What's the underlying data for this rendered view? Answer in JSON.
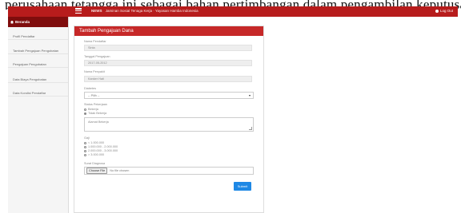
{
  "caption": "perusahaan tetangga ini sebagai bahan pertimbangan dalam pengambilan keputusan",
  "topbar": {
    "brand": "NEWS",
    "subtitle": "Jaminan Sosial Tenaga Kerja · Yayasan Hamba Indonesia",
    "logout": "Log Out"
  },
  "sidebar": {
    "header": "Beranda",
    "items": [
      "Profil Pendaftar",
      "Tambah Pengajuan Pengobatan",
      "Pengajuan Pengobatan",
      "Data Biaya Pengobatan",
      "Data Kondisi Pendaftar"
    ]
  },
  "panel": {
    "title": "Tambah Pengajuan Dana",
    "fields": [
      {
        "label": "Nama Pendaftar",
        "value": "Sinta"
      },
      {
        "label": "Tanggal Pengajuan",
        "value": "2017-05-2012"
      },
      {
        "label": "Nama Penyakit",
        "value": "Kanker Hati"
      }
    ],
    "select": {
      "label": "Diabetes",
      "value": "-- Pilih --"
    },
    "status": {
      "label": "Status Pekerjaan",
      "options": [
        "Bekerja",
        "Tidak Bekerja"
      ]
    },
    "address": {
      "placeholder": "Alamat Bekerja"
    },
    "income": {
      "label": "Gaji",
      "options": [
        "< 1.000.000",
        "1.000.000 - 2.000.000",
        "2.000.000 - 3.000.000",
        "> 3.000.000"
      ]
    },
    "upload": {
      "label": "Surat Diagnosa",
      "button": "Choose File",
      "status": "No file chosen"
    },
    "submit": "Submit"
  }
}
